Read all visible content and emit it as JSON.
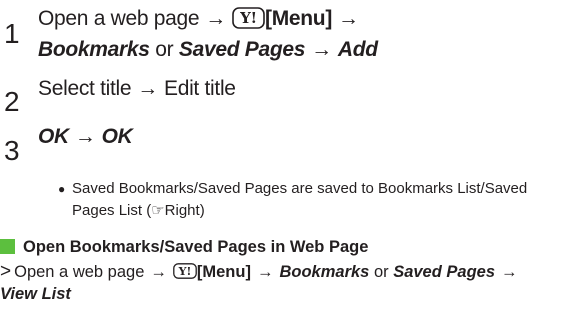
{
  "steps": [
    {
      "number": "1",
      "line1_prefix": "Open a web page",
      "arrow": "→",
      "key_label": "Y!",
      "menu_label": "[Menu]",
      "bookmarks": "Bookmarks",
      "or": "or",
      "saved_pages": "Saved Pages",
      "add": "Add"
    },
    {
      "number": "2",
      "text_a": "Select title",
      "arrow": "→",
      "text_b": "Edit title"
    },
    {
      "number": "3",
      "ok1": "OK",
      "arrow": "→",
      "ok2": "OK"
    }
  ],
  "note": {
    "bullet": "●",
    "text_line1": "Saved Bookmarks/Saved Pages are saved to Bookmarks List/Saved",
    "text_line2_prefix": "Pages List (",
    "ref_icon": "☞",
    "text_line2_ref": "Right",
    "text_line2_suffix": ")"
  },
  "section": {
    "title": "Open Bookmarks/Saved Pages in Web Page",
    "square_color": "#5cbf3e",
    "chevron": ">",
    "body_prefix": "Open a web page",
    "arrow": "→",
    "key_label": "Y!",
    "menu_label": "[Menu]",
    "bookmarks": "Bookmarks",
    "or": "or",
    "saved_pages": "Saved Pages",
    "view_list": "View List"
  }
}
